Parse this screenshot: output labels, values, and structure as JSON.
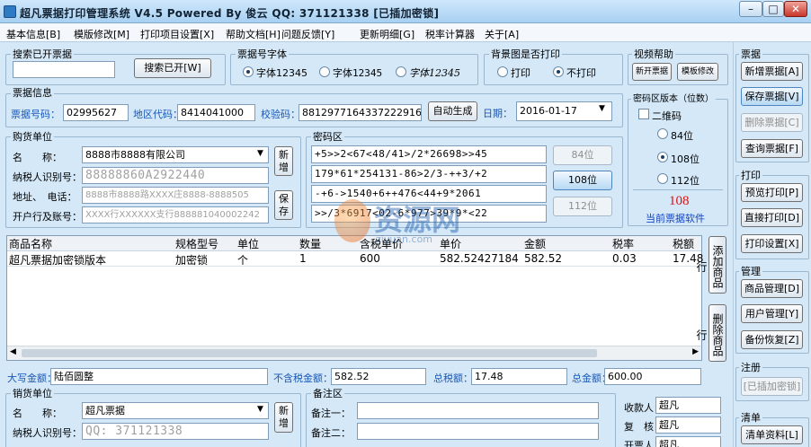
{
  "window": {
    "title": "超凡票据打印管理系统 V4.5 Powered By 俊云 QQ: 371121338 [已插加密锁]",
    "min": "–",
    "max": "□",
    "close": "✕"
  },
  "menus": [
    "基本信息[B]",
    "模版修改[M]",
    "打印项目设置[X]",
    "帮助文档[H]",
    "问题反馈[Y]",
    "更新明细[G]",
    "税率计算器",
    "关于[A]"
  ],
  "search": {
    "title": "搜索已开票据",
    "value": "",
    "button": "搜索已开[W]"
  },
  "font": {
    "title": "票据号字体",
    "options": [
      "字体12345",
      "字体12345",
      "字体12345"
    ],
    "selected": 0
  },
  "background": {
    "title": "背景图是否打印",
    "options": [
      "打印",
      "不打印"
    ],
    "selected": 1
  },
  "video": {
    "title": "视频帮助",
    "buttons": [
      "新开票据",
      "模板修改"
    ]
  },
  "info": {
    "title": "票据信息",
    "number_label": "票据号码：",
    "number": "02995627",
    "area_label": "地区代码：",
    "area": "8414041000",
    "verify_label": "校验码：",
    "verify": "88129771643372229166",
    "auto": "自动生成",
    "date_label": "日期：",
    "date": "2016-01-17"
  },
  "cipher_version": {
    "title": "密码区版本（位数）",
    "two_d": "二维码",
    "options": [
      "84位",
      "108位",
      "112位"
    ],
    "selected": 1,
    "value": "108",
    "caption": "当前票据软件"
  },
  "buyer": {
    "title": "购货单位",
    "name_label": "名　　称：",
    "name": "8888市8888有限公司",
    "tax_label": "纳税人识别号：",
    "tax": "88888860A2922440",
    "addr_label": "地址、　电话：",
    "addr": "8888市8888路XXXX庄8888-8888505",
    "bank_label": "开户行及账号：",
    "bank": "XXXX行XXXXXX支行888881040002242",
    "new": "新增",
    "save": "保存"
  },
  "cipher": {
    "title": "密码区",
    "lines": [
      "+5>>2<67<48/41>/2*26698>>45",
      "179*61*254131-86>2/3-++3/+2",
      "-+6->1540+6++476<44+9*2061",
      ">>/3*6917<02-6*977>39*9*<22"
    ],
    "buttons": [
      "84位",
      "108位",
      "112位"
    ]
  },
  "goods": {
    "headers": [
      "商品名称",
      "规格型号",
      "单位",
      "数量",
      "含税单价",
      "单价",
      "金额",
      "税率",
      "税额"
    ],
    "row": [
      "超凡票据加密锁版本",
      "加密锁",
      "个",
      "1",
      "600",
      "582.52427184",
      "582.52",
      "0.03",
      "17.48"
    ],
    "add": "添加商品行",
    "del": "删除商品行"
  },
  "totals": {
    "caps_label": "大写金额：",
    "caps": "陆佰圆整",
    "notax_label": "不含税金额：",
    "notax": "582.52",
    "taxsum_label": "总税额：",
    "taxsum": "17.48",
    "total_label": "总金额：",
    "total": "600.00"
  },
  "seller": {
    "title": "销货单位",
    "name_label": "名　　称：",
    "name": "超凡票据",
    "tax_label": "纳税人识别号：",
    "tax": "QQ: 371121338",
    "new": "新增"
  },
  "remark": {
    "title": "备注区",
    "l1": "备注一：",
    "l2": "备注二："
  },
  "people": {
    "payee_label": "收款人：",
    "payee": "超凡",
    "reviewer_label": "复　核：",
    "reviewer": "超凡",
    "drawer_label": "开票人：",
    "drawer": "超凡"
  },
  "side": {
    "bill_title": "票据",
    "bill": [
      "新增票据[A]",
      "保存票据[V]",
      "删除票据[C]",
      "查询票据[F]"
    ],
    "print_title": "打印",
    "print": [
      "预览打印[P]",
      "直接打印[D]",
      "打印设置[X]"
    ],
    "manage_title": "管理",
    "manage": [
      "商品管理[D]",
      "用户管理[Y]",
      "备份恢复[Z]"
    ],
    "reg_title": "注册",
    "reg": [
      "[已插加密锁]"
    ],
    "clear_title": "清单",
    "clear": [
      "清单资料[L]"
    ]
  },
  "watermark": {
    "text": "资源网",
    "url": "ziyuan.com"
  }
}
